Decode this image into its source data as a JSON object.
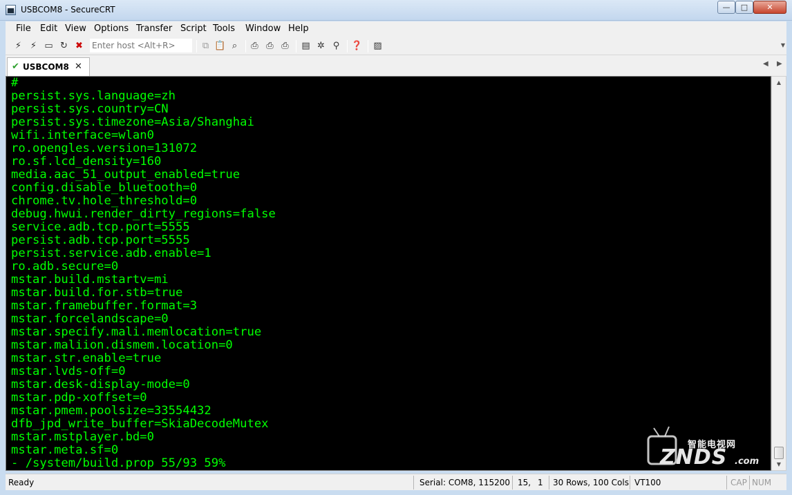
{
  "window": {
    "title": "USBCOM8 - SecureCRT",
    "controls": {
      "minimize": "—",
      "maximize": "□",
      "close": "✕"
    }
  },
  "menu": [
    "File",
    "Edit",
    "View",
    "Options",
    "Transfer",
    "Script",
    "Tools",
    "Window",
    "Help"
  ],
  "toolbar": {
    "host_placeholder": "Enter host <Alt+R>",
    "icons": [
      "connect-icon",
      "quick-connect-icon",
      "connect-in-tab-icon",
      "reconnect-icon",
      "disconnect-icon",
      "copy-icon",
      "paste-icon",
      "find-icon",
      "print-icon",
      "print-setup-icon",
      "print-screen-icon",
      "session-options-icon",
      "global-options-icon",
      "keymap-icon",
      "help-icon",
      "sftp-icon"
    ]
  },
  "tabs": [
    {
      "label": "USBCOM8",
      "active": true
    }
  ],
  "terminal": {
    "fg_color": "#00ff00",
    "bg_color": "#000000",
    "lines": [
      "#",
      "persist.sys.language=zh",
      "persist.sys.country=CN",
      "persist.sys.timezone=Asia/Shanghai",
      "wifi.interface=wlan0",
      "ro.opengles.version=131072",
      "ro.sf.lcd_density=160",
      "media.aac_51_output_enabled=true",
      "config.disable_bluetooth=0",
      "chrome.tv.hole_threshold=0",
      "debug.hwui.render_dirty_regions=false",
      "service.adb.tcp.port=5555",
      "persist.adb.tcp.port=5555",
      "persist.service.adb.enable=1",
      "ro.adb.secure=0",
      "mstar.build.mstartv=mi",
      "mstar.build.for.stb=true",
      "mstar.framebuffer.format=3",
      "mstar.forcelandscape=0",
      "mstar.specify.mali.memlocation=true",
      "mstar.maliion.dismem.location=0",
      "mstar.str.enable=true",
      "mstar.lvds-off=0",
      "mstar.desk-display-mode=0",
      "mstar.pdp-xoffset=0",
      "mstar.pmem.poolsize=33554432",
      "dfb_jpd_write_buffer=SkiaDecodeMutex",
      "mstar.mstplayer.bd=0",
      "mstar.meta.sf=0",
      "- /system/build.prop 55/93 59%"
    ]
  },
  "watermark": {
    "chinese": "智能电视网",
    "brand": "ZNDS",
    "domain": ".com"
  },
  "status": {
    "ready": "Ready",
    "serial": "Serial: COM8, 115200",
    "row": "15,",
    "col": "1",
    "size": "30 Rows, 100 Cols",
    "emulation": "VT100",
    "cap": "CAP",
    "num": "NUM"
  }
}
